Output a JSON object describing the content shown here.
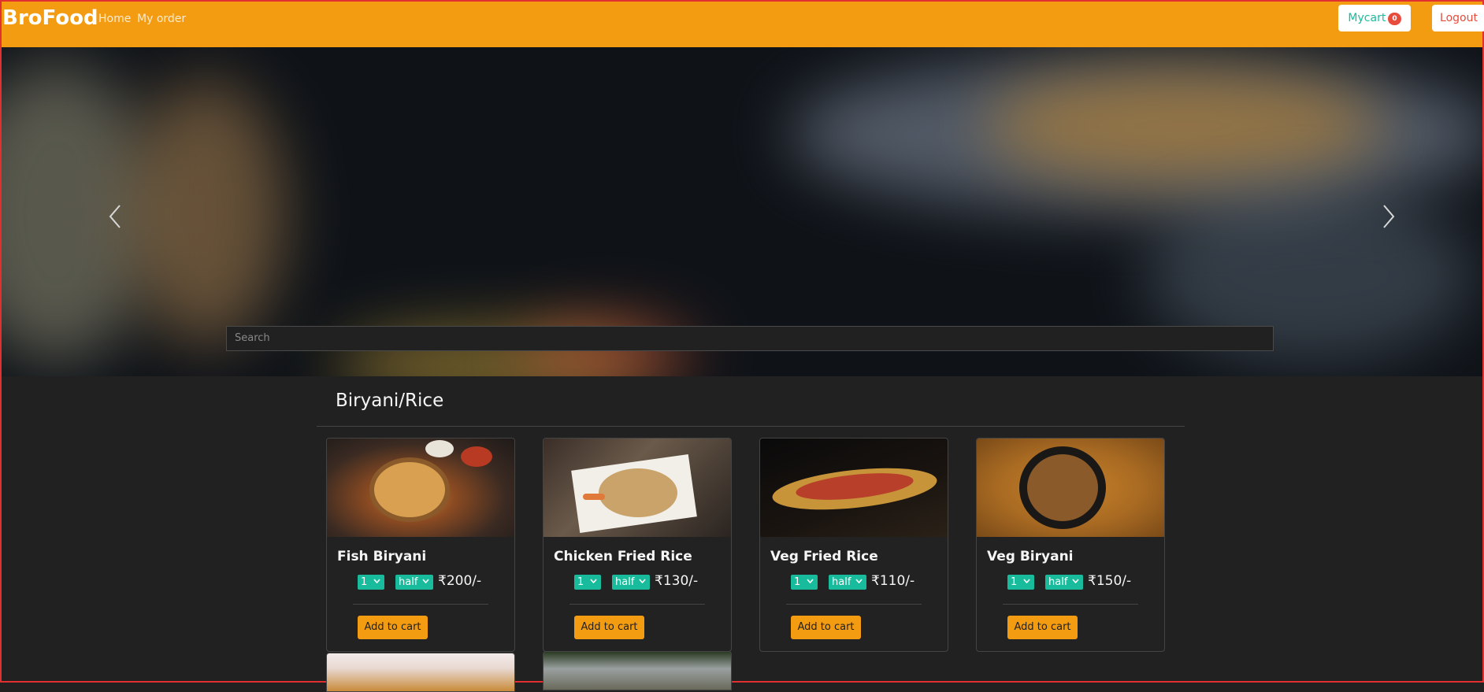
{
  "navbar": {
    "brand": "BroFood",
    "links": [
      "Home",
      "My order"
    ],
    "cart_label": "Mycart",
    "cart_count": "0",
    "logout_label": "Logout"
  },
  "hero": {
    "search_placeholder": "Search"
  },
  "section": {
    "title": "Biryani/Rice"
  },
  "cards": [
    {
      "name": "Fish Biryani",
      "qty": "1",
      "size": "half",
      "price": "₹200/-",
      "button": "Add to cart"
    },
    {
      "name": "Chicken Fried Rice",
      "qty": "1",
      "size": "half",
      "price": "₹130/-",
      "button": "Add to cart"
    },
    {
      "name": "Veg Fried Rice",
      "qty": "1",
      "size": "half",
      "price": "₹110/-",
      "button": "Add to cart"
    },
    {
      "name": "Veg Biryani",
      "qty": "1",
      "size": "half",
      "price": "₹150/-",
      "button": "Add to cart"
    }
  ],
  "colors": {
    "navbar": "#f39c12",
    "success": "#18bc9c",
    "danger": "#e74c3c",
    "background": "#212121"
  },
  "icons": [
    "chevron-left-icon",
    "chevron-right-icon",
    "chevron-down-icon"
  ]
}
